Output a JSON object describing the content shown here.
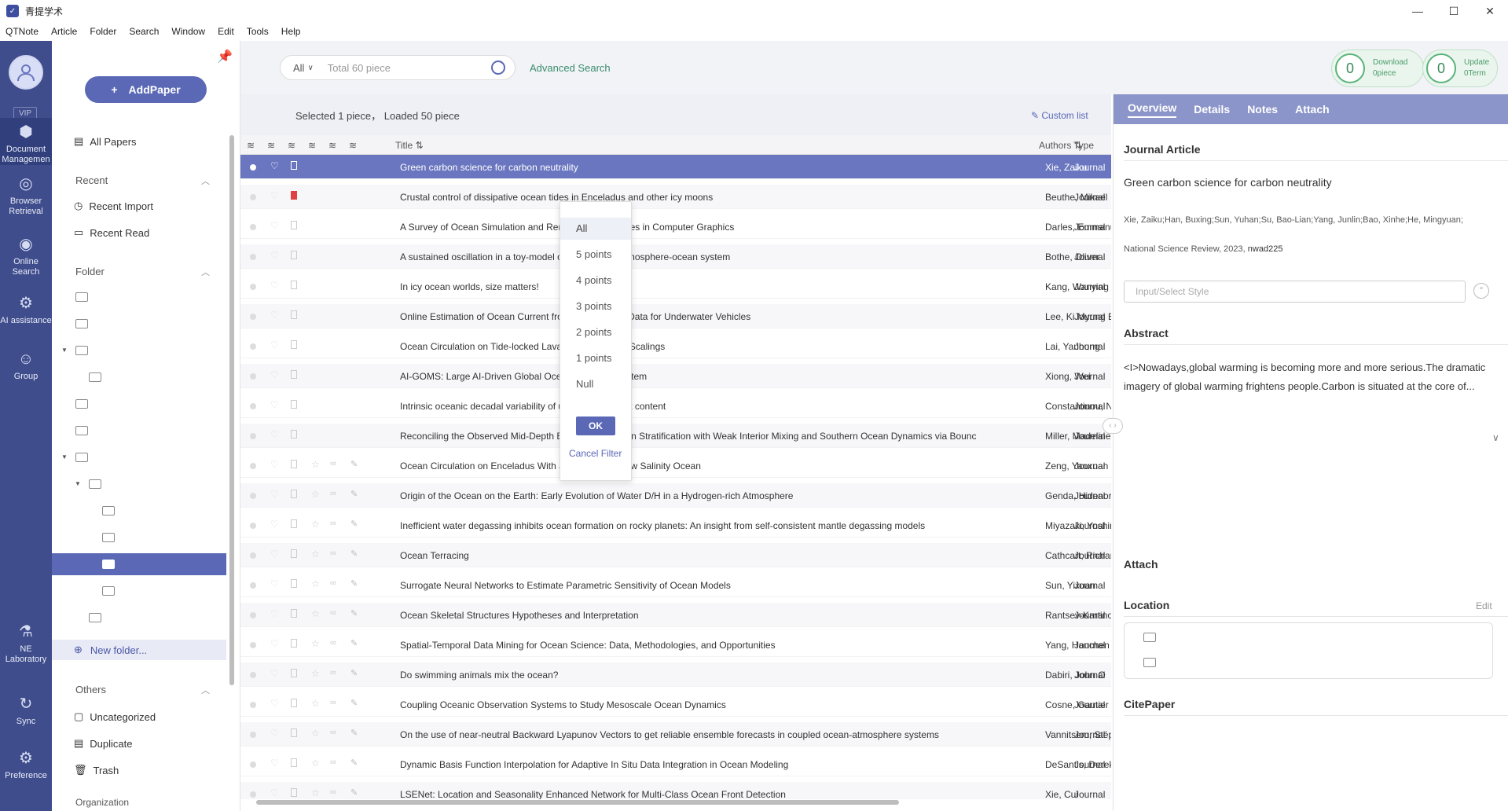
{
  "window": {
    "title": "青提学术",
    "minimize": "—",
    "maximize": "☐",
    "close": "✕"
  },
  "menu": [
    "QTNote",
    "Article",
    "Folder",
    "Search",
    "Window",
    "Edit",
    "Tools",
    "Help"
  ],
  "nav": {
    "vip": "VIP",
    "items": [
      {
        "label1": "Document",
        "label2": "Managemen",
        "icon": "cube-icon"
      },
      {
        "label1": "Browser",
        "label2": "Retrieval",
        "icon": "browser-icon"
      },
      {
        "label1": "Online",
        "label2": "Search",
        "icon": "eye-icon"
      },
      {
        "label1": "AI assistance",
        "label2": "",
        "icon": "robot-icon"
      },
      {
        "label1": "Group",
        "label2": "",
        "icon": "group-icon"
      },
      {
        "label1": "NE",
        "label2": "Laboratory",
        "icon": "flask-icon"
      },
      {
        "label1": "Sync",
        "label2": "",
        "icon": "sync-icon"
      },
      {
        "label1": "Preference",
        "label2": "",
        "icon": "gear-icon"
      }
    ]
  },
  "folders": {
    "add_paper": "AddPaper",
    "all_papers": "All Papers",
    "recent": "Recent",
    "recent_import": "Recent Import",
    "recent_read": "Recent Read",
    "folder": "Folder",
    "new_folder": "New folder...",
    "others": "Others",
    "uncategorized": "Uncategorized",
    "duplicate": "Duplicate",
    "trash": "Trash",
    "organization": "Organization"
  },
  "search": {
    "scope": "All",
    "placeholder": "Total 60 piece",
    "advanced": "Advanced Search"
  },
  "stats": {
    "download_count": "0",
    "download_label": "Download",
    "download_sub": "0piece",
    "update_count": "0",
    "update_label": "Update",
    "update_sub": "0Term"
  },
  "list": {
    "info": "Selected 1 piece， Loaded 50 piece",
    "custom_list": "Custom list",
    "col_title": "Title",
    "col_authors": "Authors",
    "col_type": "Type"
  },
  "rating_filter": {
    "options": [
      "All",
      "5 points",
      "4 points",
      "3 points",
      "2 points",
      "1 points",
      "Null"
    ],
    "ok": "OK",
    "cancel": "Cancel Filter"
  },
  "rows": [
    {
      "title": "Green carbon science for carbon neutrality",
      "author": "Xie, Zaiku",
      "type": "Journal"
    },
    {
      "title": "Crustal control of dissipative ocean tides in Enceladus and other icy moons",
      "author": "Beuthe, Mikael",
      "type": "Journal"
    },
    {
      "title": "A Survey of Ocean Simulation and Rendering Techniques in Computer Graphics",
      "author": "Darles, Emmanuelle",
      "type": "Journal"
    },
    {
      "title": "A sustained oscillation in a toy-model of the coupled atmosphere-ocean system",
      "author": "Bothe, Oliver",
      "type": "Journal"
    },
    {
      "title": "In icy ocean worlds, size matters!",
      "author": "Kang, Wanying",
      "type": "Journal"
    },
    {
      "title": "Online Estimation of Ocean Current from Sparse GPS Data for Underwater Vehicles",
      "author": "Lee, Ki Myung Brian",
      "type": "Journal"
    },
    {
      "title": "Ocean Circulation on Tide-locked Lava Worlds, Part II: Scalings",
      "author": "Lai, Yanhong",
      "type": "Journal"
    },
    {
      "title": "AI-GOMS: Large AI-Driven Global Ocean Modeling System",
      "author": "Xiong, Wei",
      "type": "Journal"
    },
    {
      "title": "Intrinsic oceanic decadal variability of upper-ocean heat content",
      "author": "Constantinou, Navid",
      "type": "Journal"
    },
    {
      "title": "Reconciling the Observed Mid-Depth Exponential Ocean Stratification with Weak Interior Mixing and Southern Ocean Dynamics via Bounc",
      "author": "Miller, Madeline D",
      "type": "Journal"
    },
    {
      "title": "Ocean Circulation on Enceladus With a High Versus Low Salinity Ocean",
      "author": "Zeng, Yaoxuan",
      "type": "Journal"
    },
    {
      "title": "Origin of the Ocean on the Earth: Early Evolution of Water D/H in a Hydrogen-rich Atmosphere",
      "author": "Genda, Hidenori",
      "type": "Journal"
    },
    {
      "title": "Inefficient water degassing inhibits ocean formation on rocky planets: An insight from self-consistent mantle degassing models",
      "author": "Miyazaki, Yoshinori",
      "type": "Journal"
    },
    {
      "title": "Ocean Terracing",
      "author": "Cathcart, Richard",
      "type": "Journal"
    },
    {
      "title": "Surrogate Neural Networks to Estimate Parametric Sensitivity of Ocean Models",
      "author": "Sun, Yixuan",
      "type": "Journal"
    },
    {
      "title": "Ocean Skeletal Structures Hypotheses and Interpretation",
      "author": "Rantsev-Kartinov, V A",
      "type": "Journal"
    },
    {
      "title": "Spatial-Temporal Data Mining for Ocean Science: Data, Methodologies, and Opportunities",
      "author": "Yang, Hanchen",
      "type": "Journal"
    },
    {
      "title": "Do swimming animals mix the ocean?",
      "author": "Dabiri, John O",
      "type": "Journal"
    },
    {
      "title": "Coupling Oceanic Observation Systems to Study Mesoscale Ocean Dynamics",
      "author": "Cosne, Gautier",
      "type": "Journal"
    },
    {
      "title": "On the use of near-neutral Backward Lyapunov Vectors to get reliable ensemble forecasts in coupled ocean-atmosphere systems",
      "author": "Vannitsem, Stéphane",
      "type": "Journal"
    },
    {
      "title": "Dynamic Basis Function Interpolation for Adaptive In Situ Data Integration in Ocean Modeling",
      "author": "DeSantis, Derek",
      "type": "Journal"
    },
    {
      "title": "LSENet: Location and Seasonality Enhanced Network for Multi-Class Ocean Front Detection",
      "author": "Xie, Cui",
      "type": "Journal"
    }
  ],
  "detail": {
    "tabs": [
      "Overview",
      "Details",
      "Notes",
      "Attach"
    ],
    "type": "Journal Article",
    "title": "Green carbon science for carbon neutrality",
    "authors": "Xie, Zaiku;Han, Buxing;Sun, Yuhan;Su, Bao-Lian;Yang, Junlin;Bao, Xinhe;He, Mingyuan;",
    "source": "National Science Review, 2023,",
    "source_id": "nwad225",
    "style_placeholder": "Input/Select Style",
    "abstract_heading": "Abstract",
    "abstract": "<I>Nowadays,global warming is becoming more and more serious.The dramatic imagery of global warming frightens people.Carbon is situated at the core of...",
    "attach_heading": "Attach",
    "location_heading": "Location",
    "edit": "Edit",
    "citepaper_heading": "CitePaper"
  }
}
